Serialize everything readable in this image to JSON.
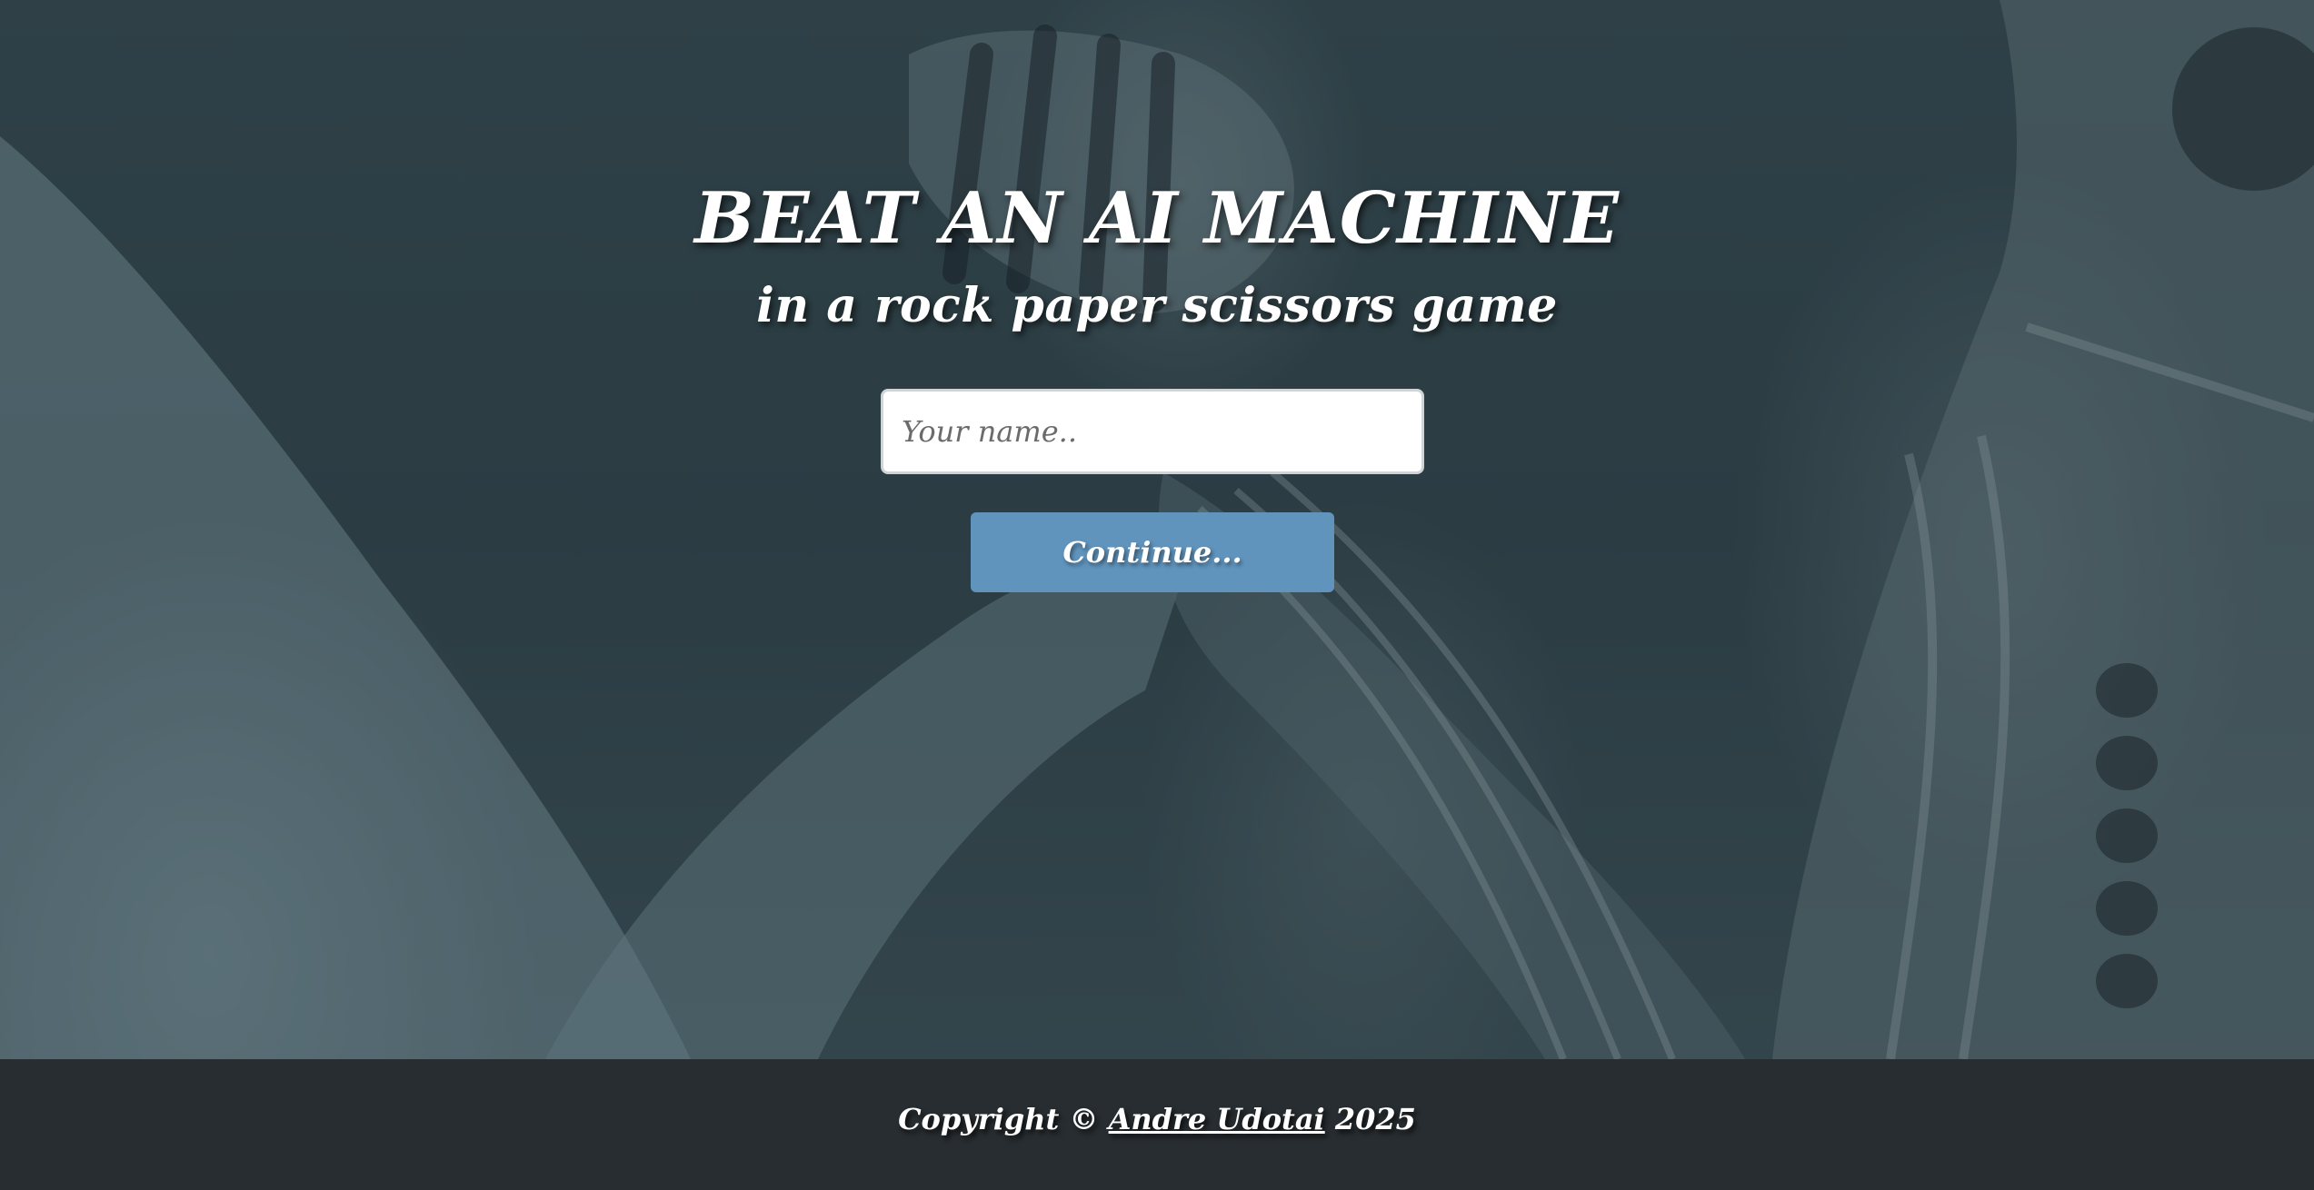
{
  "hero": {
    "title": "BEAT AN AI MACHINE",
    "subtitle": "in a rock paper scissors game"
  },
  "form": {
    "name_placeholder": "Your name..",
    "name_value": "",
    "continue_label": "Continue..."
  },
  "footer": {
    "copyright_prefix": "Copyright ©",
    "author_link": "Andre Udotai",
    "year": "2025"
  },
  "colors": {
    "button": "#6094bd",
    "footer": "#272d31",
    "overlay": "#34474d"
  },
  "background_image": "human arm wrestling a robotic arm"
}
